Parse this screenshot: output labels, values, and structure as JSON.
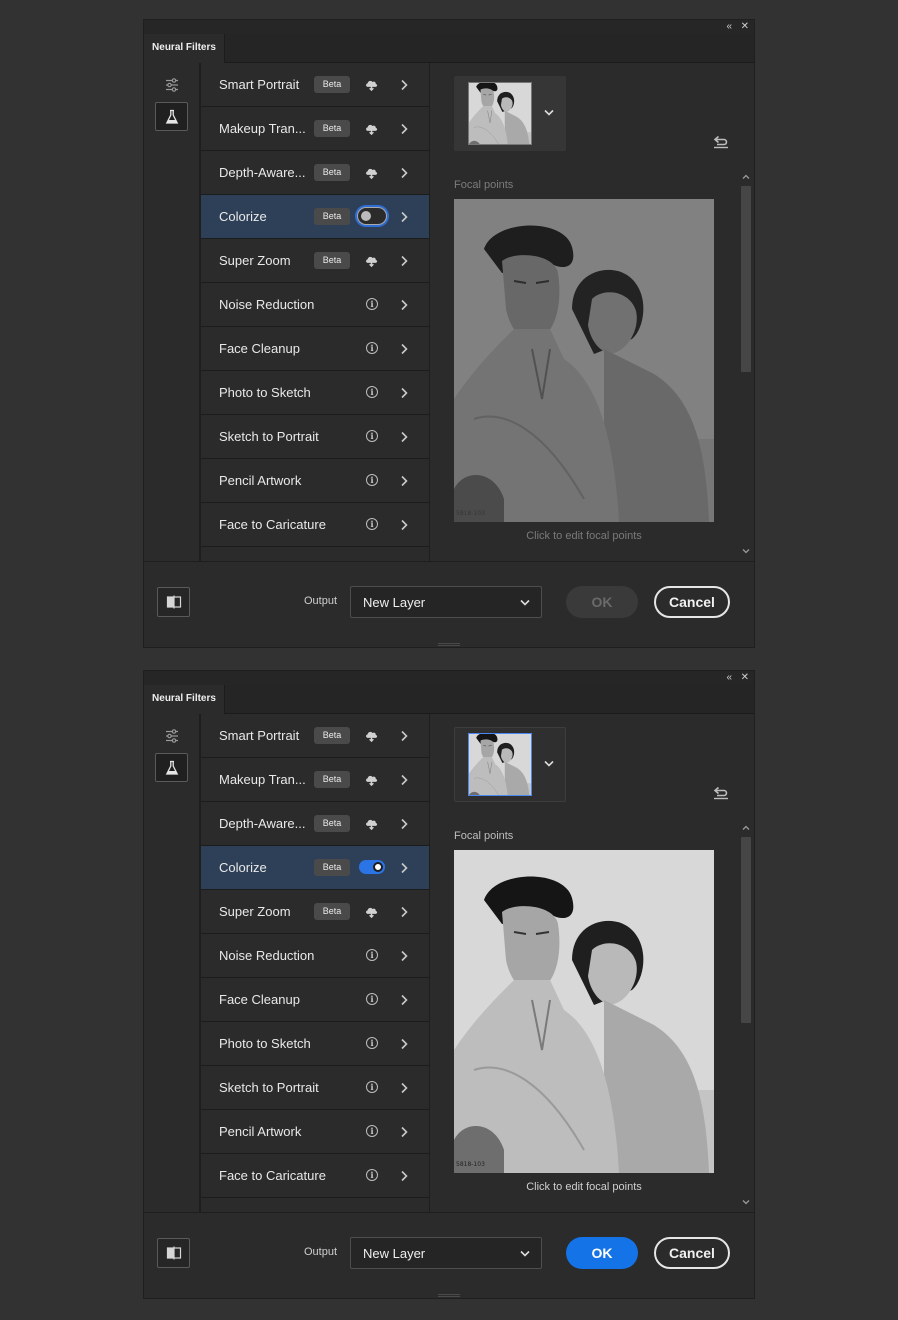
{
  "colors": {
    "background": "#323232",
    "panel": "#2b2b2b",
    "selected_row": "#2e4058",
    "accent_blue": "#1473e6"
  },
  "panels": [
    {
      "state": "colorize-off",
      "tab_title": "Neural Filters",
      "window_controls": {
        "collapse": "«",
        "close": "✕"
      },
      "icons": {
        "top": "sliders-icon",
        "active": "flask-icon"
      },
      "filters": [
        {
          "label": "Smart Portrait",
          "badge": "Beta",
          "icon": "cloud-download-icon"
        },
        {
          "label": "Makeup Tran...",
          "badge": "Beta",
          "icon": "cloud-download-icon"
        },
        {
          "label": "Depth-Aware...",
          "badge": "Beta",
          "icon": "cloud-download-icon"
        },
        {
          "label": "Colorize",
          "badge": "Beta",
          "icon": "toggle",
          "toggle": "off",
          "selected": true
        },
        {
          "label": "Super Zoom",
          "badge": "Beta",
          "icon": "cloud-download-icon"
        },
        {
          "label": "Noise Reduction",
          "icon": "info-icon"
        },
        {
          "label": "Face Cleanup",
          "icon": "info-icon"
        },
        {
          "label": "Photo to Sketch",
          "icon": "info-icon"
        },
        {
          "label": "Sketch to Portrait",
          "icon": "info-icon"
        },
        {
          "label": "Pencil Artwork",
          "icon": "info-icon"
        },
        {
          "label": "Face to Caricature",
          "icon": "info-icon"
        }
      ],
      "focal_points_label": "Focal points",
      "focal_points_hint": "Click to edit focal points",
      "photo_stamp": "5818-103",
      "output_label": "Output",
      "output_value": "New Layer",
      "ok_label": "OK",
      "ok_enabled": false,
      "cancel_label": "Cancel"
    },
    {
      "state": "colorize-on",
      "tab_title": "Neural Filters",
      "window_controls": {
        "collapse": "«",
        "close": "✕"
      },
      "icons": {
        "top": "sliders-icon",
        "active": "flask-icon"
      },
      "filters": [
        {
          "label": "Smart Portrait",
          "badge": "Beta",
          "icon": "cloud-download-icon"
        },
        {
          "label": "Makeup Tran...",
          "badge": "Beta",
          "icon": "cloud-download-icon"
        },
        {
          "label": "Depth-Aware...",
          "badge": "Beta",
          "icon": "cloud-download-icon"
        },
        {
          "label": "Colorize",
          "badge": "Beta",
          "icon": "toggle",
          "toggle": "on",
          "selected": true
        },
        {
          "label": "Super Zoom",
          "badge": "Beta",
          "icon": "cloud-download-icon"
        },
        {
          "label": "Noise Reduction",
          "icon": "info-icon"
        },
        {
          "label": "Face Cleanup",
          "icon": "info-icon"
        },
        {
          "label": "Photo to Sketch",
          "icon": "info-icon"
        },
        {
          "label": "Sketch to Portrait",
          "icon": "info-icon"
        },
        {
          "label": "Pencil Artwork",
          "icon": "info-icon"
        },
        {
          "label": "Face to Caricature",
          "icon": "info-icon"
        }
      ],
      "focal_points_label": "Focal points",
      "focal_points_hint": "Click to edit focal points",
      "photo_stamp": "5818-103",
      "output_label": "Output",
      "output_value": "New Layer",
      "ok_label": "OK",
      "ok_enabled": true,
      "cancel_label": "Cancel"
    }
  ]
}
